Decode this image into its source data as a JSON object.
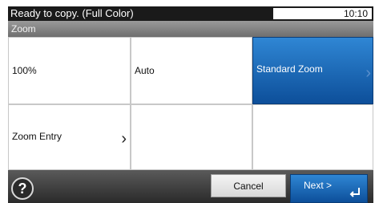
{
  "status": {
    "text": "Ready to copy. (Full Color)",
    "time": "10:10"
  },
  "title": "Zoom",
  "options": [
    {
      "label": "100%",
      "selected": false
    },
    {
      "label": "Auto",
      "selected": false
    },
    {
      "label": "Standard Zoom",
      "selected": true
    },
    {
      "label": "Zoom Entry",
      "selected": false
    }
  ],
  "footer": {
    "help_label": "?",
    "cancel_label": "Cancel",
    "next_label": "Next >"
  },
  "icons": {
    "help": "question-circle-icon",
    "chevron": "chevron-right-icon",
    "enter": "enter-return-icon"
  },
  "colors": {
    "accent": "#0d4f9a",
    "status_bar": "#1a1a1a",
    "title_bar": "#7d7d7d"
  }
}
